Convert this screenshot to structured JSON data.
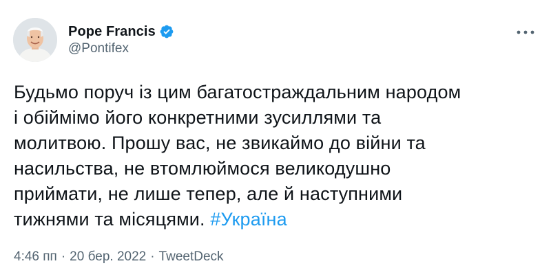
{
  "author": {
    "display_name": "Pope Francis",
    "handle": "@Pontifex",
    "verified": true
  },
  "tweet": {
    "text": "Будьмо поруч із цим багатостраждальним народом\nі обіймімо його конкретними зусиллями та\nмолитвою. Прошу вас, не звикаймо до війни та\nнасильства, не втомлюймося великодушно\nприймати, не лише тепер, але й наступними\nтижнями та місяцями. ",
    "hashtag": "#Україна"
  },
  "meta": {
    "time": "4:46 пп",
    "separator": "·",
    "date": "20 бер. 2022",
    "source": "TweetDeck"
  },
  "colors": {
    "text": "#0f1419",
    "secondary": "#536471",
    "accent": "#1d9bf0"
  },
  "icons": {
    "verified": "verified-badge-icon",
    "more": "more-options-icon"
  }
}
